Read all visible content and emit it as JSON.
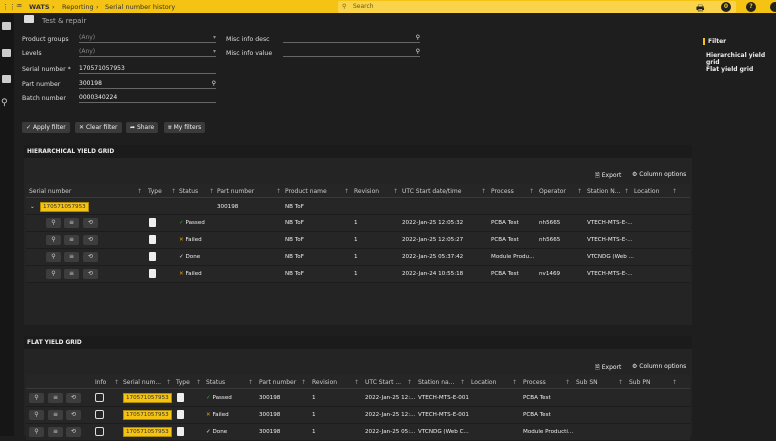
{
  "topbar": {
    "app": "WATS",
    "crumbs": [
      "Reporting",
      "Serial number history"
    ],
    "search_placeholder": "Search",
    "notif_count": "0"
  },
  "page": {
    "title": "Test & repair"
  },
  "filter": {
    "product_groups": {
      "label": "Product groups",
      "value": "(Any)"
    },
    "levels": {
      "label": "Levels",
      "value": "(Any)"
    },
    "serial": {
      "label": "Serial number *",
      "value": "170571057953"
    },
    "part": {
      "label": "Part number",
      "value": "300198"
    },
    "batch": {
      "label": "Batch number",
      "value": "0000340224"
    },
    "misc_desc": {
      "label": "Misc info desc",
      "value": ""
    },
    "misc_value": {
      "label": "Misc info value",
      "value": ""
    },
    "buttons": {
      "apply": "Apply filter",
      "clear": "Clear filter",
      "share": "Share",
      "myfilters": "My filters"
    }
  },
  "right_nav": [
    "Filter",
    "Hierarchical yield grid",
    "Flat yield grid"
  ],
  "hier": {
    "title": "HIERARCHICAL YIELD GRID",
    "export": "Export",
    "column_options": "Column options",
    "columns": [
      "Serial number",
      "Type",
      "Status",
      "Part number",
      "Product name",
      "Revision",
      "UTC Start date/time",
      "Process",
      "Operator",
      "Station N...",
      "Location"
    ],
    "parent": {
      "serial": "170571057953",
      "part": "300198",
      "product": "NB ToF"
    },
    "rows": [
      {
        "status": "Passed",
        "product": "NB ToF",
        "rev": "1",
        "date": "2022-Jan-25 12:05:32",
        "process": "PCBA Test",
        "operator": "nh5665",
        "station": "VTECH-MTS-E-..."
      },
      {
        "status": "Failed",
        "product": "NB ToF",
        "rev": "1",
        "date": "2022-Jan-25 12:05:27",
        "process": "PCBA Test",
        "operator": "nh5665",
        "station": "VTECH-MTS-E-..."
      },
      {
        "status": "Done",
        "product": "NB ToF",
        "rev": "1",
        "date": "2022-Jan-25 05:37:42",
        "process": "Module Produ...",
        "operator": "",
        "station": "VTCNDG (Web ..."
      },
      {
        "status": "Failed",
        "product": "NB ToF",
        "rev": "1",
        "date": "2022-Jan-24 10:55:18",
        "process": "PCBA Test",
        "operator": "nv1469",
        "station": "VTECH-MTS-E-..."
      }
    ]
  },
  "flat": {
    "title": "FLAT YIELD GRID",
    "export": "Export",
    "column_options": "Column options",
    "columns": [
      "Info",
      "Serial num...",
      "Type",
      "Status",
      "Part number",
      "Revision",
      "UTC Start ...",
      "Station na...",
      "Location",
      "Process",
      "Sub SN",
      "Sub PN"
    ],
    "rows": [
      {
        "serial": "170571057953",
        "status": "Passed",
        "part": "300198",
        "rev": "1",
        "date": "2022-Jan-25 12:...",
        "station": "VTECH-MTS-E-001",
        "process": "PCBA Test"
      },
      {
        "serial": "170571057953",
        "status": "Failed",
        "part": "300198",
        "rev": "1",
        "date": "2022-Jan-25 12:...",
        "station": "VTECH-MTS-E-001",
        "process": "PCBA Test"
      },
      {
        "serial": "170571057953",
        "status": "Done",
        "part": "300198",
        "rev": "1",
        "date": "2022-Jan-25 05:...",
        "station": "VTCNDG (Web C...",
        "process": "Module Producti..."
      }
    ]
  },
  "colors": {
    "accent": "#f5c313",
    "passed": "#3a9a3a",
    "failed": "#e8a000"
  }
}
